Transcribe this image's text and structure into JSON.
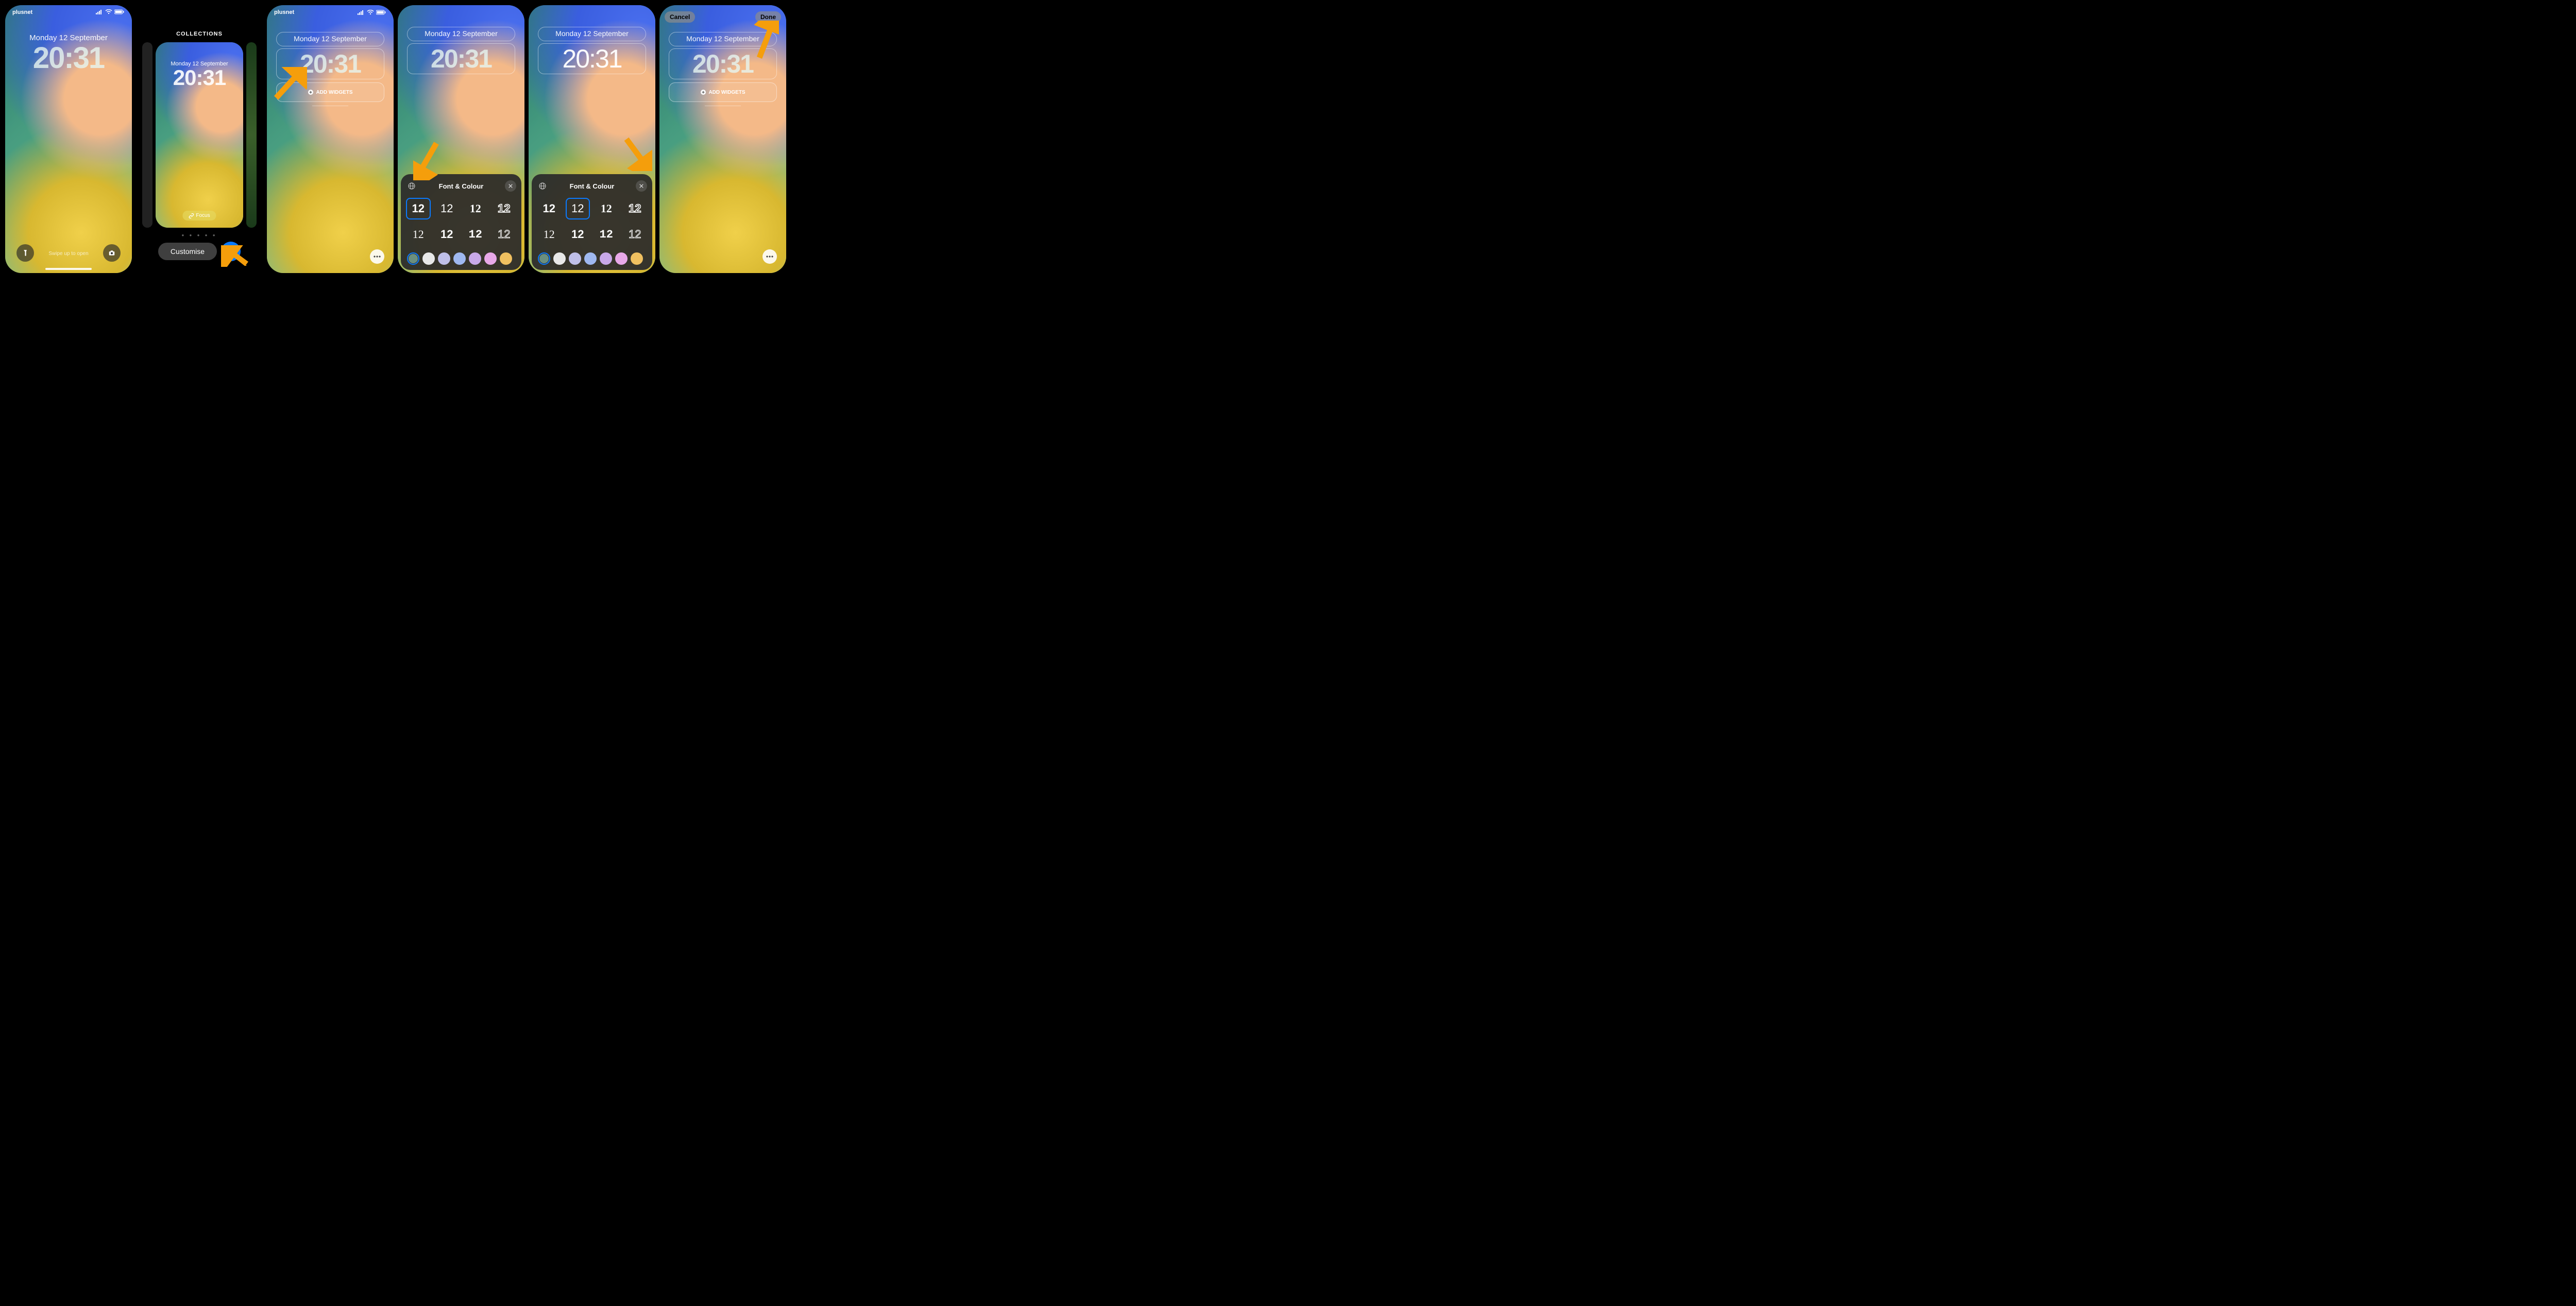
{
  "status": {
    "carrier": "plusnet"
  },
  "lock": {
    "date": "Monday 12 September",
    "time": "20:31",
    "swipe_hint": "Swipe up to open"
  },
  "gallery": {
    "header": "COLLECTIONS",
    "focus_label": "Focus",
    "customise_label": "Customise"
  },
  "editor": {
    "add_widgets_label": "ADD WIDGETS",
    "cancel_label": "Cancel",
    "done_label": "Done"
  },
  "sheet": {
    "title": "Font & Colour",
    "sample": "12",
    "colors": [
      "#6b8f7f",
      "#e8e8e8",
      "#bfbfe8",
      "#9fb8f0",
      "#c8a8e8",
      "#e8a8e8",
      "#f0c060"
    ]
  }
}
